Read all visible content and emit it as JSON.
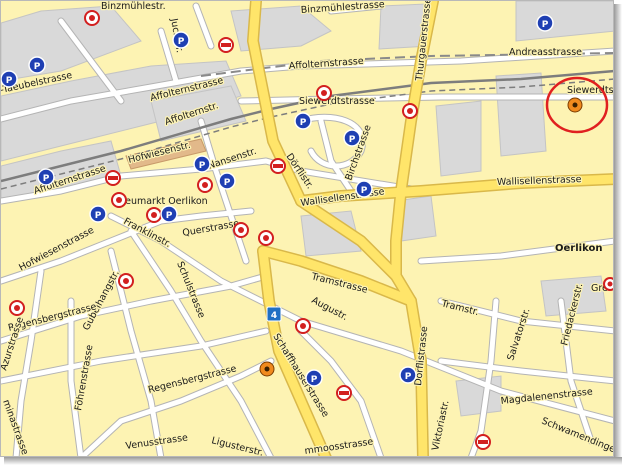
{
  "map": {
    "colors": {
      "land": "#fdf3b3",
      "built_area": "#d8d8d8",
      "main_road": "#ffe56a",
      "main_road_edge": "#d9b84a",
      "minor_road": "#ffffff",
      "minor_road_edge": "#b4b4b4",
      "railway": "#8a8a8a",
      "highlight_circle": "#e02020",
      "parking_blue": "#1f3fb3"
    },
    "district_label": "Oerlikon",
    "route_shield": "4",
    "street_labels": [
      {
        "key": "binzmuehlestr",
        "text": "Binzmühlestr."
      },
      {
        "key": "binzmuehlestrasse",
        "text": "Binzmühlestrasse"
      },
      {
        "key": "andreasstrasse",
        "text": "Andreasstrasse"
      },
      {
        "key": "thurgauerstrasse",
        "text": "Thurgauerstrasse"
      },
      {
        "key": "affolternstrasse_top",
        "text": "Affolternstrasse"
      },
      {
        "key": "affolternstrasse_mid",
        "text": "Affolternstrasse"
      },
      {
        "key": "affolternstrasse_left",
        "text": "Affolternstrasse"
      },
      {
        "key": "affolternstr",
        "text": "Affolternstr."
      },
      {
        "key": "juchstr",
        "text": "Juchstr."
      },
      {
        "key": "taeubelstrasse",
        "text": "-Taeubelstrasse"
      },
      {
        "key": "siewerdtstrasse",
        "text": "Siewerdtstrasse"
      },
      {
        "key": "siewerdtst",
        "text": "Siewerdtst"
      },
      {
        "key": "hofwiesenstr",
        "text": "Hofwiesenstr."
      },
      {
        "key": "nansenstr",
        "text": "Nansenstr."
      },
      {
        "key": "doerflistr",
        "text": "Dörflistr."
      },
      {
        "key": "birchstrasse",
        "text": "Birchstrasse"
      },
      {
        "key": "wallisellenstrasse_mid",
        "text": "Wallisellenstrasse"
      },
      {
        "key": "wallisellenstrasse_right",
        "text": "Wallisellenstrasse"
      },
      {
        "key": "neumarkt",
        "text": "Neumarkt Oerlikon"
      },
      {
        "key": "frankinstr",
        "text": "Franklinstr."
      },
      {
        "key": "hofwiesenstrasse",
        "text": "Hofwiesenstrasse"
      },
      {
        "key": "querstrasse",
        "text": "Querstrasse"
      },
      {
        "key": "tramstrasse",
        "text": "Tramstrasse"
      },
      {
        "key": "tramstr",
        "text": "Tramstr."
      },
      {
        "key": "schulstrasse",
        "text": "Schulstrasse"
      },
      {
        "key": "gubelhangstr",
        "text": "Gubelhangstr."
      },
      {
        "key": "augustr",
        "text": "Augustr."
      },
      {
        "key": "doerflistrasse",
        "text": "Dörflistrasse"
      },
      {
        "key": "regensbergstrasse_a",
        "text": "Regensbergstrasse"
      },
      {
        "key": "regensbergstrasse_b",
        "text": "Regensbergstrasse"
      },
      {
        "key": "schaffhauserstrasse",
        "text": "Schaffhauserstrasse"
      },
      {
        "key": "azurstrasse",
        "text": "Azurstrasse"
      },
      {
        "key": "foehrenstrasse",
        "text": "Föhrenstrasse"
      },
      {
        "key": "viktoriastr",
        "text": "Viktoriastr."
      },
      {
        "key": "salvatorstr",
        "text": "Salvatorstr."
      },
      {
        "key": "friedackerstr",
        "text": "Friedackerstr."
      },
      {
        "key": "magdalenenstrasse",
        "text": "Magdalenenstrasse"
      },
      {
        "key": "schwamendingenstr",
        "text": "Schwamendingenstr."
      },
      {
        "key": "ligusterstr",
        "text": "Ligusterstr."
      },
      {
        "key": "venusstrasse",
        "text": "Venusstrasse"
      },
      {
        "key": "gubelstrasse",
        "text": "mmoosstrasse"
      },
      {
        "key": "greifensee",
        "text": "Grei"
      },
      {
        "key": "cranachstrasse",
        "text": "minastrasse"
      }
    ]
  }
}
